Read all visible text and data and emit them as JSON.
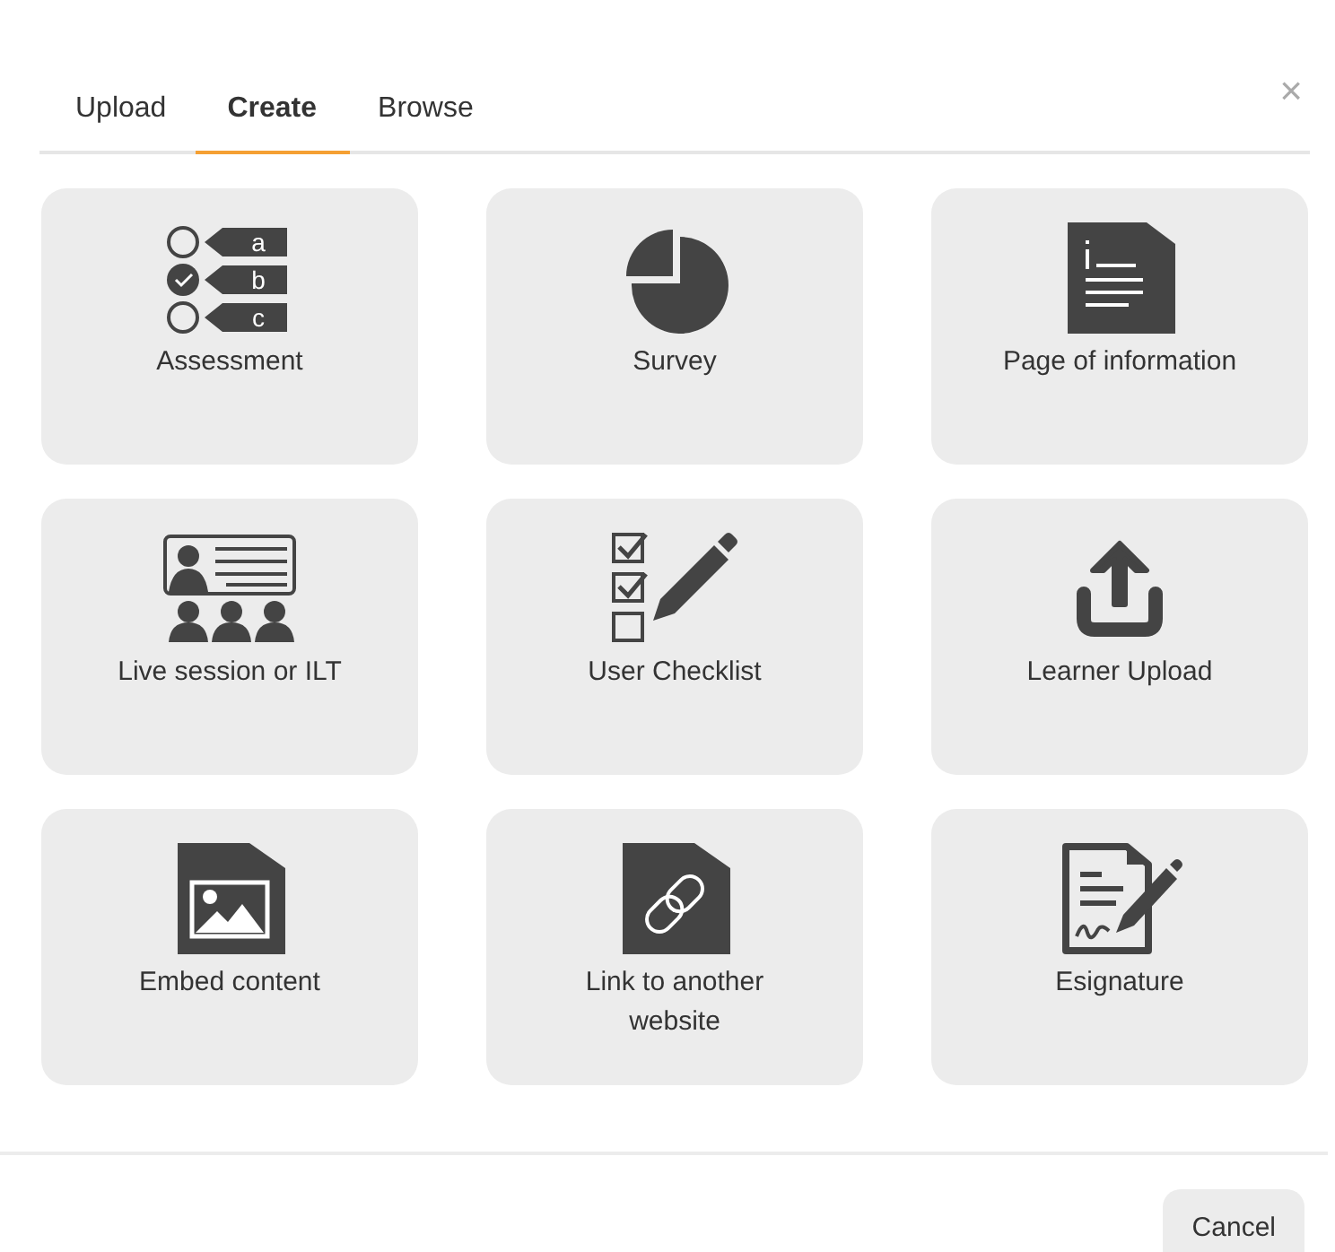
{
  "tabs": [
    {
      "label": "Upload",
      "selected": false
    },
    {
      "label": "Create",
      "selected": true
    },
    {
      "label": "Browse",
      "selected": false
    }
  ],
  "close": "×",
  "tiles": [
    {
      "kind": "assessment",
      "label": "Assessment",
      "options": [
        "a",
        "b",
        "c"
      ]
    },
    {
      "kind": "survey",
      "label": "Survey"
    },
    {
      "kind": "page",
      "label": "Page of information"
    },
    {
      "kind": "live",
      "label": "Live session or ILT"
    },
    {
      "kind": "checklist",
      "label": "User Checklist"
    },
    {
      "kind": "upload",
      "label": "Learner Upload"
    },
    {
      "kind": "embed",
      "label": "Embed content"
    },
    {
      "kind": "link",
      "label": "Link to another website"
    },
    {
      "kind": "esignature",
      "label": "Esignature"
    }
  ],
  "buttons": [
    "Cancel"
  ]
}
